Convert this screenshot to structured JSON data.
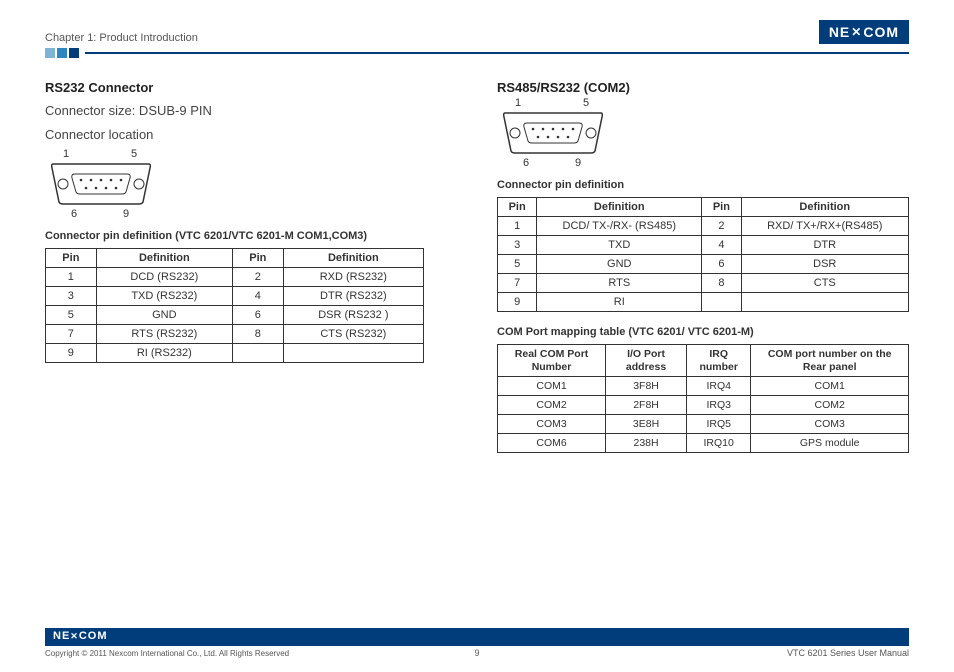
{
  "header": {
    "chapter": "Chapter 1: Product Introduction",
    "logo_text": "NEXCOM"
  },
  "left": {
    "title": "RS232 Connector",
    "sub1": "Connector size: DSUB-9 PIN",
    "sub2": "Connector location",
    "conn_labels": {
      "tl": "1",
      "tr": "5",
      "bl": "6",
      "br": "9"
    },
    "table_caption": "Connector pin definition (VTC 6201/VTC 6201-M  COM1,COM3)",
    "table_headers": [
      "Pin",
      "Definition",
      "Pin",
      "Definition"
    ],
    "table_rows": [
      [
        "1",
        "DCD (RS232)",
        "2",
        "RXD (RS232)"
      ],
      [
        "3",
        "TXD (RS232)",
        "4",
        "DTR (RS232)"
      ],
      [
        "5",
        "GND",
        "6",
        "DSR (RS232 )"
      ],
      [
        "7",
        "RTS (RS232)",
        "8",
        "CTS (RS232)"
      ],
      [
        "9",
        "RI (RS232)",
        "",
        ""
      ]
    ]
  },
  "right": {
    "title": "RS485/RS232 (COM2)",
    "conn_labels": {
      "tl": "1",
      "tr": "5",
      "bl": "6",
      "br": "9"
    },
    "table1_caption": "Connector pin definition",
    "table1_headers": [
      "Pin",
      "Definition",
      "Pin",
      "Definition"
    ],
    "table1_rows": [
      [
        "1",
        "DCD/ TX-/RX- (RS485)",
        "2",
        "RXD/ TX+/RX+(RS485)"
      ],
      [
        "3",
        "TXD",
        "4",
        "DTR"
      ],
      [
        "5",
        "GND",
        "6",
        "DSR"
      ],
      [
        "7",
        "RTS",
        "8",
        "CTS"
      ],
      [
        "9",
        "RI",
        "",
        ""
      ]
    ],
    "table2_caption": "COM Port mapping table (VTC 6201/ VTC 6201-M)",
    "table2_headers": [
      "Real COM Port Number",
      "I/O Port address",
      "IRQ number",
      "COM port number on the Rear panel"
    ],
    "table2_rows": [
      [
        "COM1",
        "3F8H",
        "IRQ4",
        "COM1"
      ],
      [
        "COM2",
        "2F8H",
        "IRQ3",
        "COM2"
      ],
      [
        "COM3",
        "3E8H",
        "IRQ5",
        "COM3"
      ],
      [
        "COM6",
        "238H",
        "IRQ10",
        "GPS module"
      ]
    ]
  },
  "footer": {
    "logo_text": "NEXCOM",
    "copyright": "Copyright © 2011 Nexcom International Co., Ltd. All Rights Reserved",
    "page": "9",
    "manual": "VTC 6201 Series User Manual"
  }
}
